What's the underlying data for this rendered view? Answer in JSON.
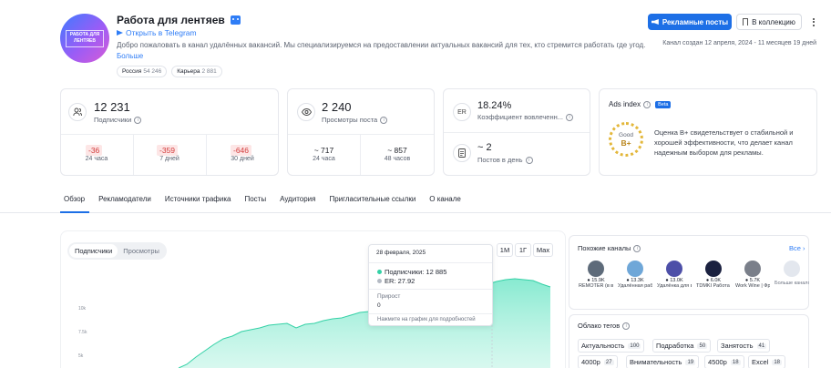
{
  "channel": {
    "title": "Работа для лентяев",
    "avatar_text": "РАБОТА ДЛЯ ЛЕНТЯЕВ",
    "open_telegram": "Открыть в Telegram",
    "description": "Добро пожаловать в канал удалённых вакансий. Мы специализируемся на предоставлении актуальных вакансий для тех, кто стремится работать где угод...",
    "more": "Больше",
    "tags": [
      {
        "label": "Россия",
        "count": "54 246"
      },
      {
        "label": "Карьера",
        "count": "2 881"
      }
    ],
    "created": "Канал создан 12 апреля, 2024 - 11 месяцев 19 дней"
  },
  "actions": {
    "ads": "Рекламные посты",
    "collection": "В коллекцию"
  },
  "stats": {
    "subscribers": {
      "value": "12 231",
      "label": "Подписчики",
      "changes": [
        {
          "value": "-36",
          "period": "24 часа"
        },
        {
          "value": "-359",
          "period": "7 дней"
        },
        {
          "value": "-646",
          "period": "30 дней"
        }
      ]
    },
    "views": {
      "value": "2 240",
      "label": "Просмотры поста",
      "breakdown": [
        {
          "value": "~ 717",
          "period": "24 часа"
        },
        {
          "value": "~ 857",
          "period": "48 часов"
        }
      ]
    },
    "er": {
      "icon": "ER",
      "value": "18.24%",
      "label": "Коэффициент вовлеченн..."
    },
    "posts": {
      "value": "~ 2",
      "label": "Постов в день"
    },
    "ads_index": {
      "title": "Ads index",
      "beta": "Beta",
      "grade_label": "Good",
      "grade": "B+",
      "description": "Оценка B+ свидетельствует о стабильной и хорошей эффективности, что делает канал надежным выбором для рекламы."
    }
  },
  "tabs": [
    "Обзор",
    "Рекламодатели",
    "Источники трафика",
    "Посты",
    "Аудитория",
    "Пригласительные ссылки",
    "О канале"
  ],
  "chart": {
    "toggle": [
      "Подписчики",
      "Просмотры"
    ],
    "ranges": [
      "1M",
      "1Г",
      "Max"
    ],
    "y_ticks": [
      "10k",
      "7.5k",
      "5k"
    ],
    "tooltip": {
      "date": "28 февраля, 2025",
      "subs": "Подписчики: 12 885",
      "er": "ER: 27.92",
      "growth_label": "Прирост",
      "growth_value": "0",
      "hint": "Нажмите на график для подробностей"
    }
  },
  "similar": {
    "title": "Похожие каналы",
    "all": "Все",
    "items": [
      {
        "count": "15.9K",
        "name": "REMOTER (в вакансии н..."
      },
      {
        "count": "13.3K",
        "name": "Удалённая работа"
      },
      {
        "count": "13.0K",
        "name": "Удалёнка для всех"
      },
      {
        "count": "6.0K",
        "name": "TDMKI Работа на..."
      },
      {
        "count": "5.7K",
        "name": "Work Wine | Фриланс..."
      },
      {
        "count": "",
        "name": "Больше каналов"
      }
    ]
  },
  "tag_cloud": {
    "title": "Облако тегов",
    "items": [
      {
        "label": "Актуальность",
        "count": "100"
      },
      {
        "label": "Подработка",
        "count": "50"
      },
      {
        "label": "Занятость",
        "count": "41"
      },
      {
        "label": "4000р",
        "count": "27"
      },
      {
        "label": "Внимательность",
        "count": "19"
      },
      {
        "label": "4500р",
        "count": "18"
      },
      {
        "label": "Excel",
        "count": "18"
      }
    ]
  }
}
